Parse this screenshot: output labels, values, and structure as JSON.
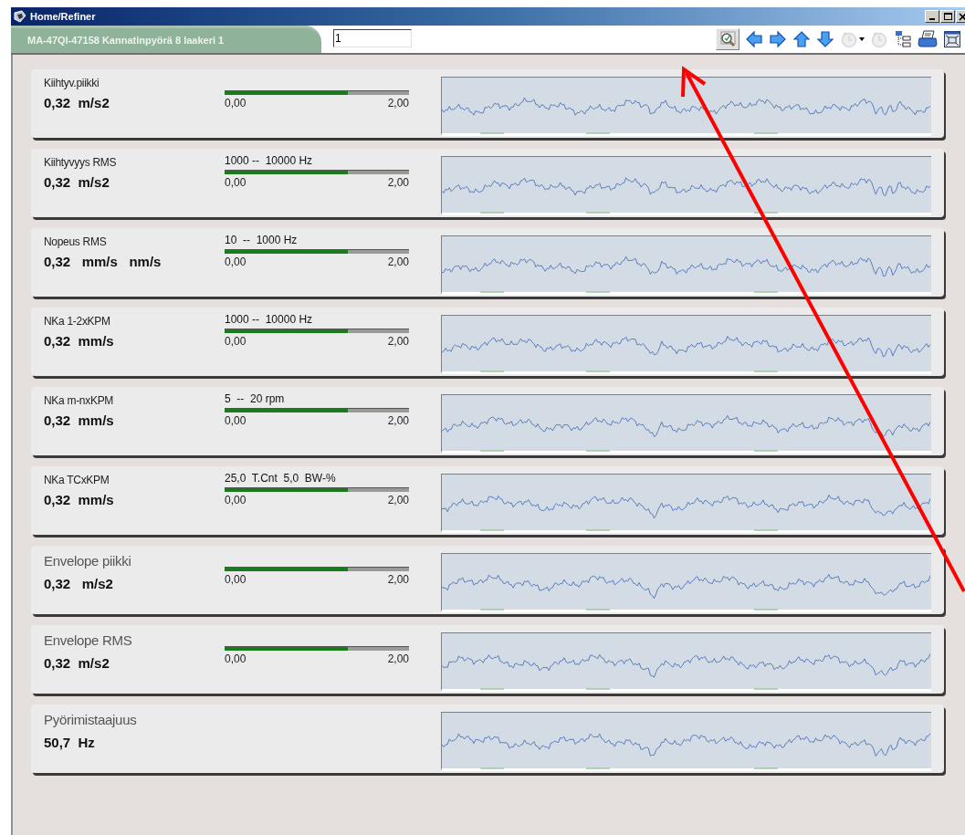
{
  "window": {
    "title": "Home/Refiner"
  },
  "header": {
    "tab_label": "MA-47QI-47158 Kannatinpyörä 8 laakeri 1",
    "field_value": "1"
  },
  "toolbar": [
    {
      "kind": "zoom",
      "pressed": true,
      "disabled": false
    },
    {
      "kind": "left",
      "pressed": false,
      "disabled": false
    },
    {
      "kind": "right",
      "pressed": false,
      "disabled": false
    },
    {
      "kind": "up",
      "pressed": false,
      "disabled": false
    },
    {
      "kind": "down",
      "pressed": false,
      "disabled": false
    },
    {
      "kind": "clock-back",
      "pressed": false,
      "disabled": true
    },
    {
      "kind": "clock-forward",
      "pressed": false,
      "disabled": true
    },
    {
      "kind": "tree",
      "pressed": false,
      "disabled": false
    },
    {
      "kind": "print",
      "pressed": false,
      "disabled": false
    },
    {
      "kind": "frame",
      "pressed": false,
      "disabled": false
    }
  ],
  "cards": [
    {
      "label": "Kiihtyv.piikki",
      "value": "0,32  m/s2",
      "gauge": {
        "level": 0.67,
        "min": "0,00",
        "max": "2,00"
      }
    },
    {
      "label": "Kiihtyvyys RMS",
      "value": "0,32  m/s2",
      "range": "1000 --  10000 Hz",
      "gauge": {
        "level": 0.67,
        "min": "0,00",
        "max": "2,00"
      }
    },
    {
      "label": "Nopeus RMS",
      "value": "0,32   mm/s   nm/s",
      "range": "10  --  1000 Hz",
      "gauge": {
        "level": 0.67,
        "min": "0,00",
        "max": "2,00"
      }
    },
    {
      "label": "NKa 1-2xKPM",
      "value": "0,32  mm/s",
      "range": "1000 --  10000 Hz",
      "gauge": {
        "level": 0.67,
        "min": "0,00",
        "max": "2,00"
      }
    },
    {
      "label": "NKa m-nxKPM",
      "value": "0,32  mm/s",
      "range": "5  --  20 rpm",
      "gauge": {
        "level": 0.67,
        "min": "0,00",
        "max": "2,00"
      }
    },
    {
      "label": "NKa TCxKPM",
      "value": "0,32  mm/s",
      "range": "25,0  T.Cnt  5,0  BW-%",
      "gauge": {
        "level": 0.67,
        "min": "0,00",
        "max": "2,00"
      }
    },
    {
      "label": "Envelope piikki",
      "value": "0,32   m/s2",
      "gauge": {
        "level": 0.67,
        "min": "0,00",
        "max": "2,00"
      }
    },
    {
      "label": "Envelope RMS",
      "value": "0,32  m/s2",
      "gauge": {
        "level": 0.67,
        "min": "0,00",
        "max": "2,00"
      }
    },
    {
      "label": "Pyörimistaajuus",
      "value": "50,7  Hz"
    }
  ]
}
